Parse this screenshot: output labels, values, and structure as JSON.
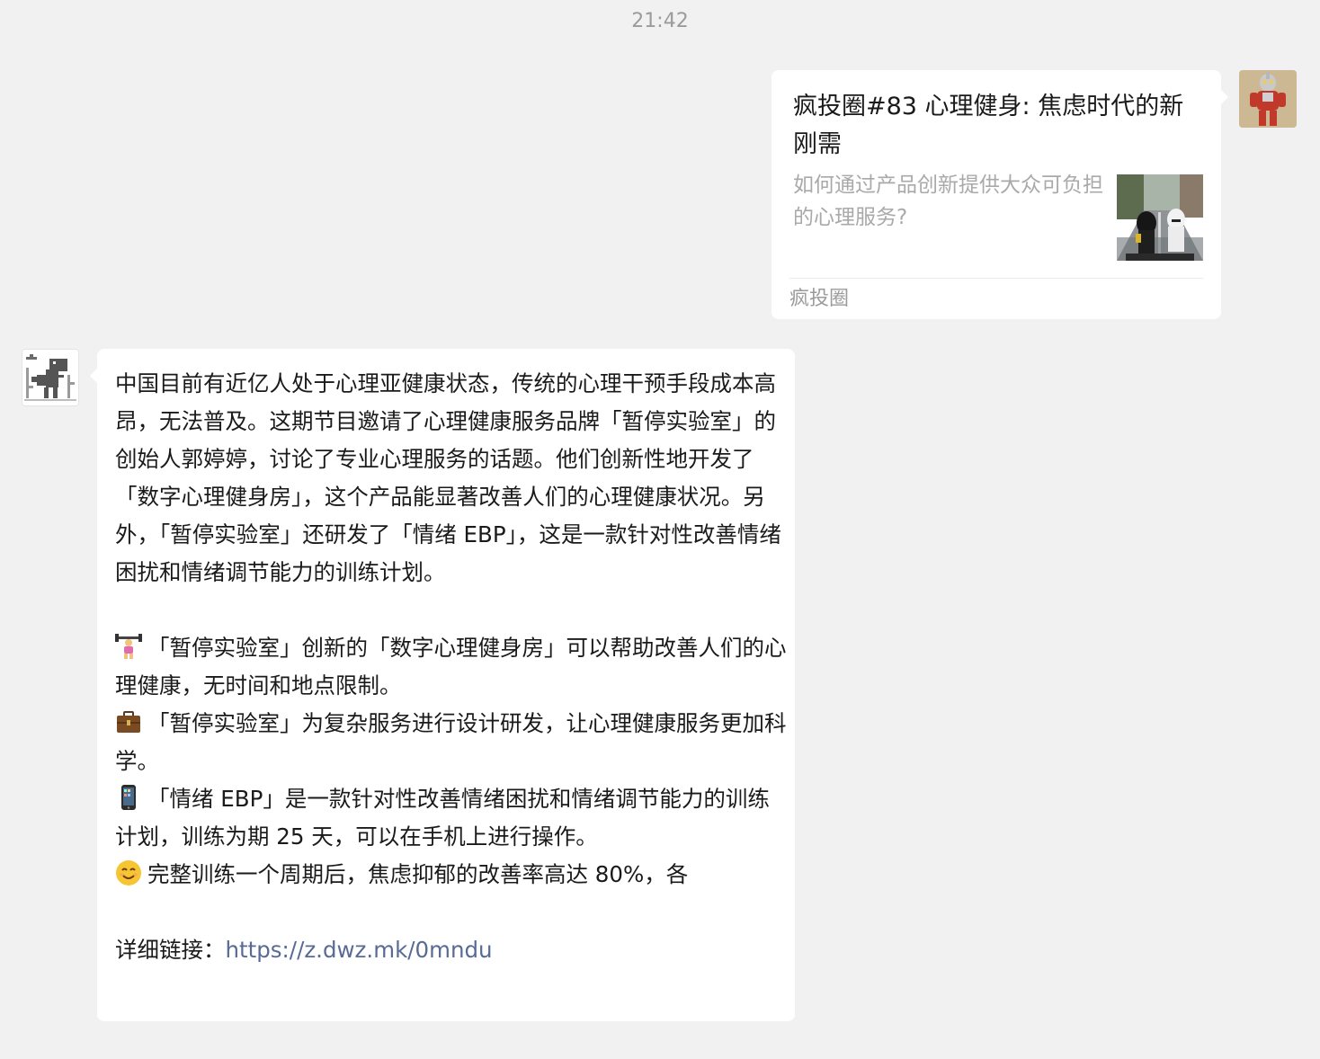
{
  "timestamp": "21:42",
  "outgoing_card": {
    "title": "疯投圈#83 心理健身: 焦虑时代的新刚需",
    "description": "如何通过产品创新提供大众可负担的心理服务?",
    "source": "疯投圈",
    "avatar_icon": "robot-figure-avatar",
    "thumbnail_icon": "figurines-on-road-thumbnail"
  },
  "incoming_message": {
    "avatar_icon": "pixel-dinosaur-avatar",
    "paragraph_1": "中国目前有近亿人处于心理亚健康状态，传统的心理干预手段成本高昂，无法普及。这期节目邀请了心理健康服务品牌「暂停实验室」的创始人郭婷婷，讨论了专业心理服务的话题。他们创新性地开发了「数字心理健身房」，这个产品能显著改善人们的心理健康状况。另外，「暂停实验室」还研发了「情绪 EBP」，这是一款针对性改善情绪困扰和情绪调节能力的训练计划。",
    "bullets": [
      {
        "emoji": "weightlifter-emoji",
        "text": "「暂停实验室」创新的「数字心理健身房」可以帮助改善人们的心理健康，无时间和地点限制。"
      },
      {
        "emoji": "briefcase-emoji",
        "text": "「暂停实验室」为复杂服务进行设计研发，让心理健康服务更加科学。"
      },
      {
        "emoji": "mobile-phone-emoji",
        "text": "「情绪 EBP」是一款针对性改善情绪困扰和情绪调节能力的训练计划，训练为期 25 天，可以在手机上进行操作。"
      },
      {
        "emoji": "smiling-face-emoji",
        "text": "完整训练一个周期后，焦虑抑郁的改善率高达 80%，各"
      }
    ],
    "link_label": "详细链接：",
    "link_url": "https://z.dwz.mk/0mndu"
  }
}
